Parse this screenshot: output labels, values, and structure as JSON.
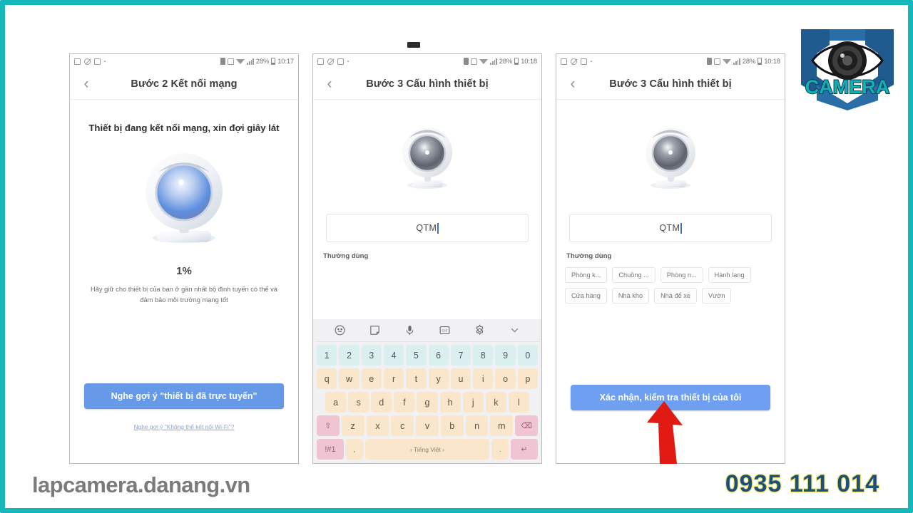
{
  "branding": {
    "logo_text": "CAMERA",
    "footer_url": "lapcamera.danang.vn",
    "footer_phone": "0935 111 014",
    "frame_color": "#14b8b8",
    "accent_blue": "#6699e8",
    "arrow_color": "#e11b13"
  },
  "screens": [
    {
      "id": "screen-1",
      "statusbar": {
        "battery": "28%",
        "time": "10:17"
      },
      "appbar": {
        "back": "‹",
        "title": "Bước 2 Kết nối mạng"
      },
      "heading": "Thiết bị đang kết nối mạng, xin đợi giây lát",
      "progress": "1%",
      "hint": "Hãy giữ cho thiết bị của bạn ở gần nhất bộ định tuyến có thể và đảm bảo môi trường mạng tốt",
      "primary_button": "Nghe gợi ý \"thiết bị đã trực tuyến\"",
      "link": "Nghe gợi ý \"Không thể kết nối Wi-Fi\"?"
    },
    {
      "id": "screen-2",
      "statusbar": {
        "battery": "28%",
        "time": "10:18"
      },
      "appbar": {
        "back": "‹",
        "title": "Bước 3 Cấu hình thiết bị"
      },
      "input_value": "QTM",
      "common_label": "Thường dùng"
    },
    {
      "id": "screen-3",
      "statusbar": {
        "battery": "28%",
        "time": "10:18"
      },
      "appbar": {
        "back": "‹",
        "title": "Bước 3 Cấu hình thiết bị"
      },
      "input_value": "QTM",
      "common_label": "Thường dùng",
      "chips": [
        "Phòng k...",
        "Chuồng ...",
        "Phòng n...",
        "Hành lang",
        "Cửa hàng",
        "Nhà kho",
        "Nhà để xe",
        "Vườn"
      ],
      "primary_button": "Xác nhận, kiểm tra thiết bị của tôi"
    }
  ],
  "keyboard": {
    "toolbar_icons": [
      "emoji-icon",
      "sticker-icon",
      "microphone-icon",
      "gif-icon",
      "settings-icon",
      "chevron-down-icon"
    ],
    "row_numbers": [
      "1",
      "2",
      "3",
      "4",
      "5",
      "6",
      "7",
      "8",
      "9",
      "0"
    ],
    "row_top": [
      "q",
      "w",
      "e",
      "r",
      "t",
      "y",
      "u",
      "i",
      "o",
      "p"
    ],
    "row_mid": [
      "a",
      "s",
      "d",
      "f",
      "g",
      "h",
      "j",
      "k",
      "l"
    ],
    "row_bot": [
      "z",
      "x",
      "c",
      "v",
      "b",
      "n",
      "m"
    ],
    "shift_key": "⇧",
    "backspace_key": "⌫",
    "symbols_key": "!#1",
    "comma_key": ",",
    "period_key": ".",
    "space_key": "‹ Tiếng Việt ›",
    "enter_key": "↵"
  }
}
